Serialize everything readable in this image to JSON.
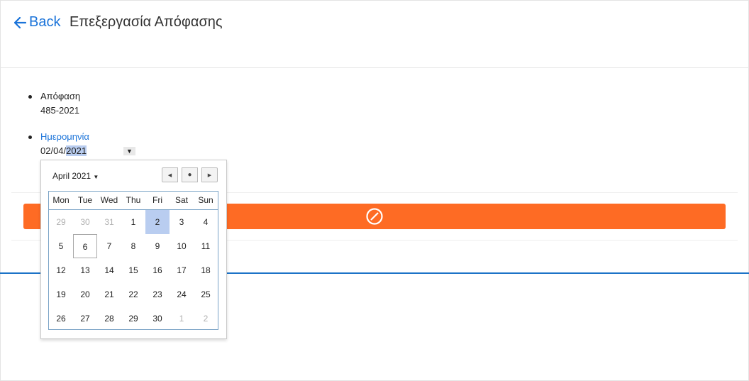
{
  "header": {
    "back_label": "Back",
    "title": "Επεξεργασία Απόφασης"
  },
  "fields": {
    "decision": {
      "label": "Απόφαση",
      "value": "485-2021"
    },
    "date": {
      "label": "Ημερομηνία",
      "value_prefix": "02/04/",
      "value_year": "2021",
      "toggle": "▼"
    }
  },
  "datepicker": {
    "month_label": "April 2021",
    "weekdays": [
      "Mon",
      "Tue",
      "Wed",
      "Thu",
      "Fri",
      "Sat",
      "Sun"
    ],
    "weeks": [
      [
        "29",
        "30",
        "31",
        "1",
        "2",
        "3",
        "4"
      ],
      [
        "5",
        "6",
        "7",
        "8",
        "9",
        "10",
        "11"
      ],
      [
        "12",
        "13",
        "14",
        "15",
        "16",
        "17",
        "18"
      ],
      [
        "19",
        "20",
        "21",
        "22",
        "23",
        "24",
        "25"
      ],
      [
        "26",
        "27",
        "28",
        "29",
        "30",
        "1",
        "2"
      ]
    ],
    "selected_day": "2",
    "today_day": "6"
  },
  "colors": {
    "accent": "#1a73d9",
    "action_bar": "#fe6b24",
    "selected_day": "#b9cdf0",
    "divider": "#1c73c7"
  },
  "icons": {
    "back": "arrow-left-icon",
    "action": "prohibited-icon",
    "prev": "caret-left-icon",
    "today": "dot-icon",
    "next": "caret-right-icon",
    "month_menu": "caret-down-icon"
  }
}
